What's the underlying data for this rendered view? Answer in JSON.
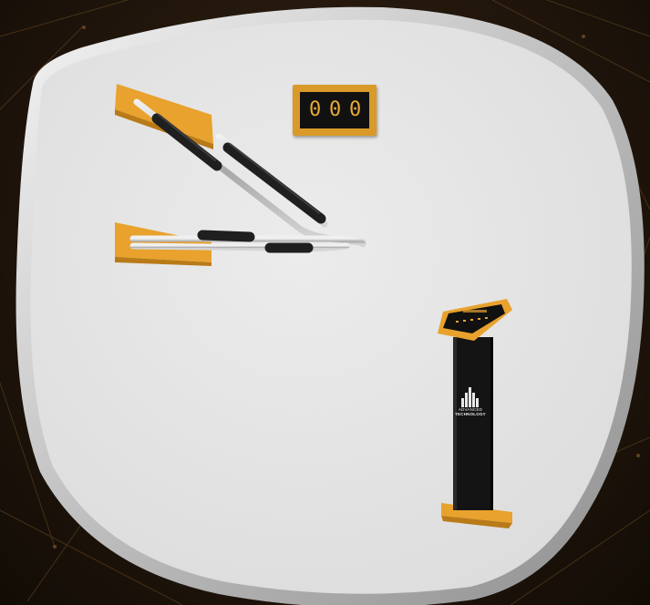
{
  "counter": {
    "digits": [
      "0",
      "0",
      "0"
    ]
  },
  "kiosk": {
    "brand_line1": "ADVANCED",
    "brand_line2": "TECHNOLOGY"
  },
  "colors": {
    "accent": "#e8a22d",
    "panel": "#e5e5e5",
    "background": "#1e140b",
    "grip": "#1f1f1f"
  },
  "icons": {
    "equipment": "wall-mounted-dip-bars-icon",
    "kiosk": "information-kiosk-icon",
    "logo": "advanced-technology-logo-icon"
  }
}
